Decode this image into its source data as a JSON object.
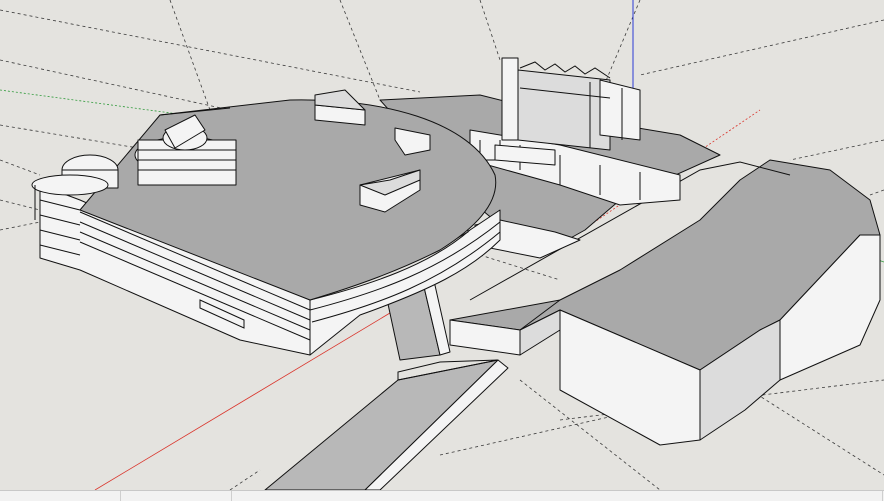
{
  "app": {
    "type": "3d-modeling-viewport"
  },
  "colors": {
    "background": "#e4e3df",
    "axis_red": "#d9342b",
    "axis_green": "#2f9a3a",
    "axis_blue": "#2b3bd6",
    "roof_fill": "#a9a9a9",
    "wall_fill": "#f4f4f4",
    "edge": "#111111"
  },
  "icons": {
    "axes": "axes-icon"
  }
}
